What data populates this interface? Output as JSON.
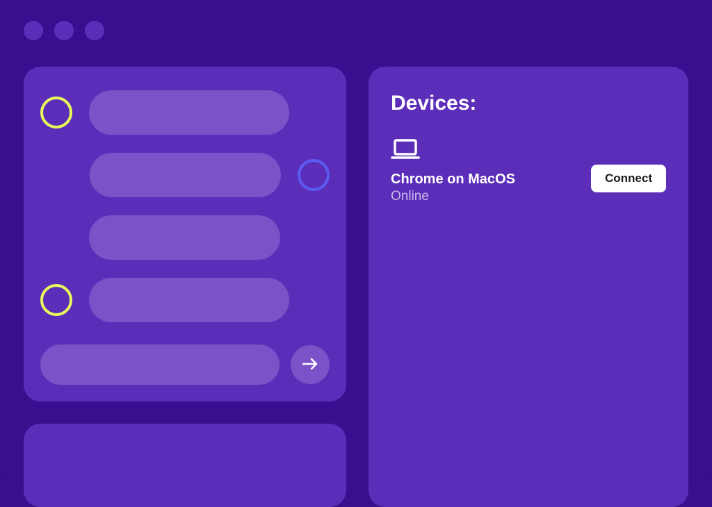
{
  "devices": {
    "title": "Devices:",
    "items": [
      {
        "name": "Chrome on MacOS",
        "status": "Online",
        "action_label": "Connect"
      }
    ]
  },
  "chat": {
    "messages": [
      {
        "side": "left",
        "avatar_color": "yellow"
      },
      {
        "side": "right",
        "avatar_color": "blue"
      },
      {
        "side": "left-indent"
      },
      {
        "side": "left",
        "avatar_color": "yellow"
      }
    ],
    "send_icon": "arrow-right"
  },
  "colors": {
    "bg": "#3A0E8E",
    "panel": "#5C2DB8",
    "bubble": "#7B52C7",
    "avatar_yellow": "#E8F85C",
    "avatar_blue": "#5B5BF0"
  }
}
